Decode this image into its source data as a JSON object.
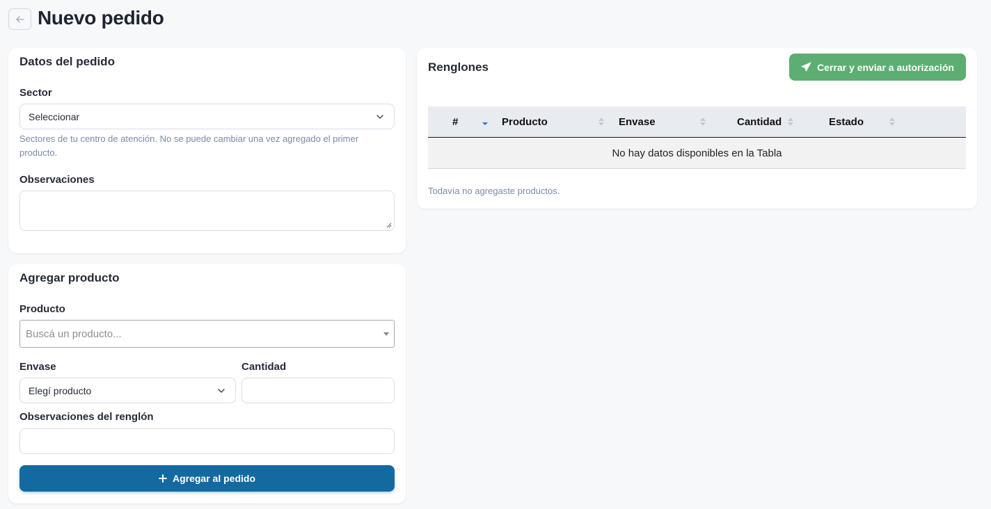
{
  "page": {
    "title": "Nuevo pedido",
    "back_icon": "arrow-left-icon"
  },
  "order_card": {
    "title": "Datos del pedido",
    "sector_label": "Sector",
    "sector_value": "Seleccionar",
    "sector_help": "Sectores de tu centro de atención. No se puede cambiar una vez agregado el primer producto.",
    "observations_label": "Observaciones",
    "observations_value": ""
  },
  "product_card": {
    "title": "Agregar producto",
    "product_label": "Producto",
    "product_placeholder": "Buscá un producto...",
    "package_label": "Envase",
    "package_value": "Elegí producto",
    "quantity_label": "Cantidad",
    "quantity_value": "",
    "row_observations_label": "Observaciones del renglón",
    "row_observations_value": "",
    "add_button_label": "Agregar al pedido"
  },
  "lines_card": {
    "title": "Renglones",
    "submit_button_label": "Cerrar y enviar a autorización",
    "columns": [
      "#",
      "Producto",
      "Envase",
      "Cantidad",
      "Estado"
    ],
    "empty_message": "No hay datos disponibles en la Tabla",
    "footer_note": "Todavía no agregaste productos."
  },
  "colors": {
    "primary": "#126aa1",
    "success": "#5dae72",
    "help_text": "#7b8aa5",
    "sort_active": "#2f6fd6"
  }
}
